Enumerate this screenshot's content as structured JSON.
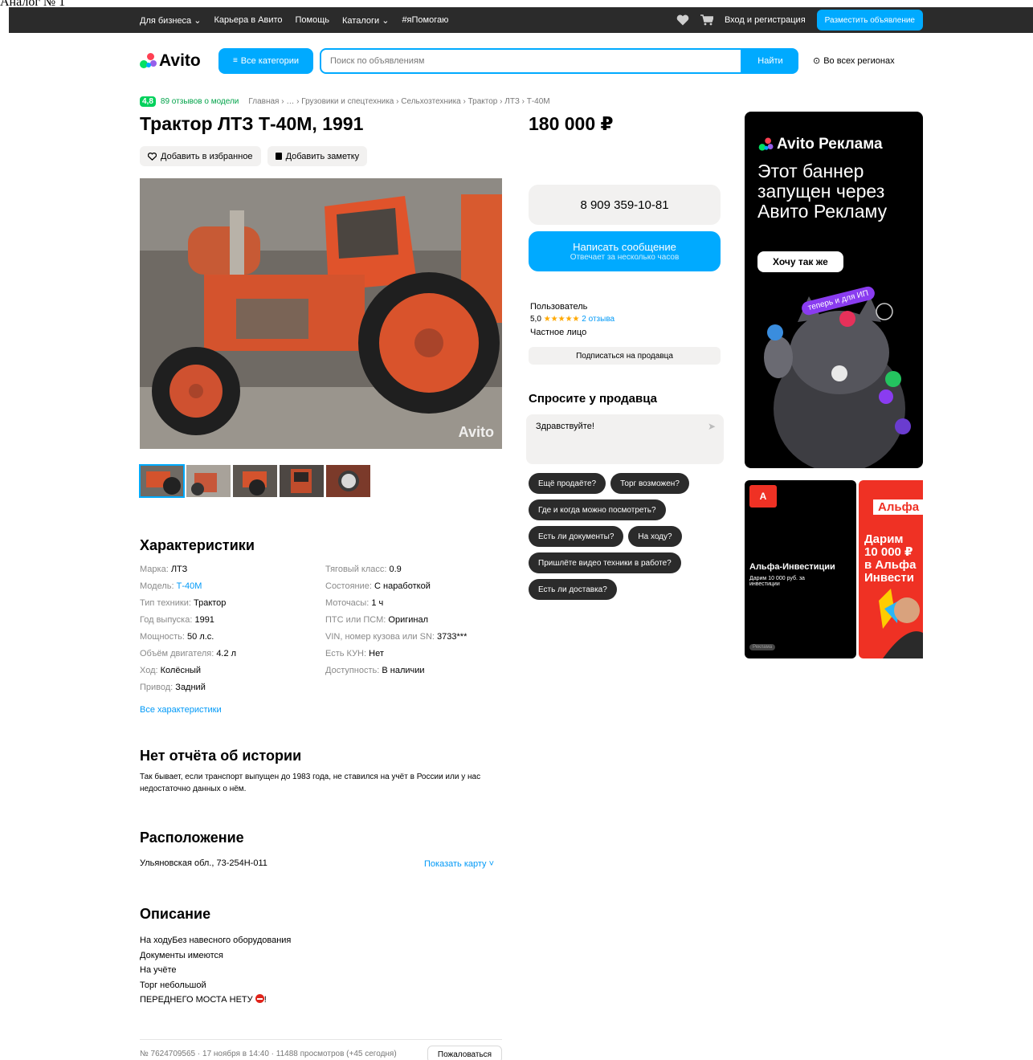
{
  "caption": "Аналог № 1",
  "topbar": {
    "nav": [
      "Для бизнеса",
      "Карьера в Авито",
      "Помощь",
      "Каталоги",
      "#яПомогаю"
    ],
    "login": "Вход и регистрация",
    "post_ad": "Разместить объявление"
  },
  "header": {
    "logo": "Avito",
    "categories": "Все категории",
    "search_placeholder": "Поиск по объявлениям",
    "search_button": "Найти",
    "region": "Во всех регионах"
  },
  "breadcrumbs": {
    "rating": "4,8",
    "reviews": "89 отзывов о модели",
    "path": "Главная › … › Грузовики и спецтехника › Сельхозтехника › Трактор › ЛТЗ › Т-40М"
  },
  "listing": {
    "title": "Трактор ЛТЗ Т-40М, 1991",
    "price": "180 000 ₽",
    "add_favorite": "Добавить в избранное",
    "add_note": "Добавить заметку",
    "photo_watermark": "Avito"
  },
  "contact": {
    "phone": "8 909 359-10-81",
    "message_button": "Написать сообщение",
    "message_sub": "Отвечает за несколько часов",
    "seller_name": "Пользователь",
    "seller_rating": "5,0",
    "seller_stars": "★★★★★",
    "seller_reviews": "2 отзыва",
    "seller_type": "Частное лицо",
    "subscribe": "Подписаться на продавца"
  },
  "ask": {
    "heading": "Спросите у продавца",
    "input_value": "Здравствуйте!",
    "questions": [
      "Ещё продаёте?",
      "Торг возможен?",
      "Где и когда можно посмотреть?",
      "Есть ли документы?",
      "На ходу?",
      "Пришлёте видео техники в работе?",
      "Есть ли доставка?"
    ]
  },
  "specs": {
    "heading": "Характеристики",
    "left": [
      {
        "k": "Марка: ",
        "v": "ЛТЗ"
      },
      {
        "k": "Модель: ",
        "v": "Т-40М"
      },
      {
        "k": "Тип техники: ",
        "v": "Трактор"
      },
      {
        "k": "Год выпуска: ",
        "v": "1991"
      },
      {
        "k": "Мощность: ",
        "v": "50 л.с."
      },
      {
        "k": "Объём двигателя: ",
        "v": "4.2 л"
      },
      {
        "k": "Ход: ",
        "v": "Колёсный"
      },
      {
        "k": "Привод: ",
        "v": "Задний"
      }
    ],
    "right": [
      {
        "k": "Тяговый класс: ",
        "v": "0.9"
      },
      {
        "k": "Состояние: ",
        "v": "С наработкой"
      },
      {
        "k": "Моточасы: ",
        "v": "1 ч"
      },
      {
        "k": "ПТС или ПСМ: ",
        "v": "Оригинал"
      },
      {
        "k": "VIN, номер кузова или SN: ",
        "v": "3733***"
      },
      {
        "k": "Есть КУН: ",
        "v": "Нет"
      },
      {
        "k": "Доступность: ",
        "v": "В наличии"
      }
    ],
    "all_link": "Все характеристики"
  },
  "history": {
    "heading": "Нет отчёта об истории",
    "text": "Так бывает, если транспорт выпущен до 1983 года, не ставился на учёт в России или у нас недостаточно данных о нём."
  },
  "location": {
    "heading": "Расположение",
    "address": "Ульяновская обл., 73-254Н-011",
    "map_link": "Показать карту ˅"
  },
  "description": {
    "heading": "Описание",
    "lines": [
      "На ходуБез навесного оборудования",
      "Документы имеются",
      "На учёте",
      "Торг небольшой",
      "ПЕРЕДНЕГО МОСТА НЕТУ"
    ],
    "last_suffix": "!"
  },
  "footer": {
    "meta": "№ 7624709565 · 17 ноября в 14:40 · 11488 просмотров (+45 сегодня)",
    "report": "Пожаловаться"
  },
  "ads": {
    "ad1_brand": "Avito Реклама",
    "ad1_text": "Этот баннер запущен через Авито Рекламу",
    "ad1_button": "Хочу так же",
    "ad1_pill": "теперь и для ИП",
    "ad2_logo": "А",
    "ad2_title": "Альфа-Инвестиции",
    "ad2_sub": "Дарим 10 000 руб. за инвестиции",
    "ad2_mark": "Реклама",
    "ad3_top": "Альфа I",
    "ad3_big": "Дарим\n10 000 ₽\nв Альфа\nИнвести"
  },
  "colors": {
    "accent": "#00aaff",
    "rating_green": "#02d15c",
    "dark": "#2b2b2b",
    "alfa_red": "#ef3124"
  }
}
